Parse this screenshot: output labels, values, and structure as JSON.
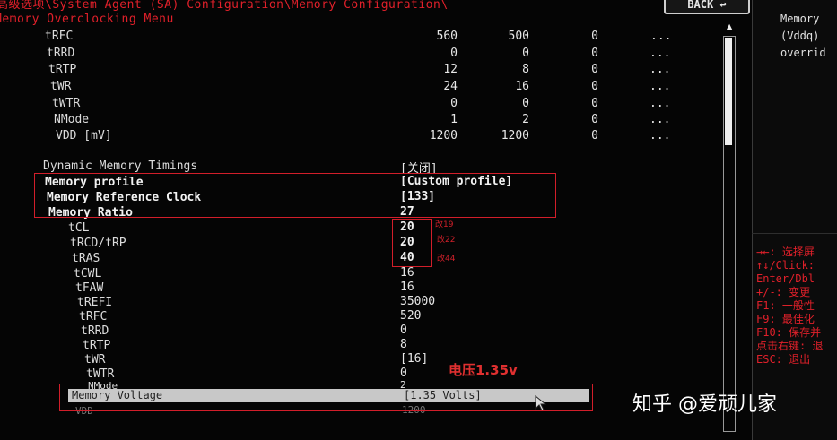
{
  "header": {
    "breadcrumb": "\\System Agent (SA) Configuration\\Memory Configuration\\",
    "menu_title": "Memory Overclocking Menu",
    "back_label": "BACK"
  },
  "top_table": {
    "rows": [
      {
        "label": "tRFC",
        "v1": "560",
        "v2": "500",
        "v3": "0",
        "v4": "..."
      },
      {
        "label": "tRRD",
        "v1": "0",
        "v2": "0",
        "v3": "0",
        "v4": "..."
      },
      {
        "label": "tRTP",
        "v1": "12",
        "v2": "8",
        "v3": "0",
        "v4": "..."
      },
      {
        "label": "tWR",
        "v1": "24",
        "v2": "16",
        "v3": "0",
        "v4": "..."
      },
      {
        "label": "tWTR",
        "v1": "0",
        "v2": "0",
        "v3": "0",
        "v4": "..."
      },
      {
        "label": "NMode",
        "v1": "1",
        "v2": "2",
        "v3": "0",
        "v4": "..."
      },
      {
        "label": "VDD [mV]",
        "v1": "1200",
        "v2": "1200",
        "v3": "0",
        "v4": "..."
      }
    ]
  },
  "settings": [
    {
      "label": "Dynamic Memory Timings",
      "value": "[关闭]"
    },
    {
      "label": "Memory profile",
      "value": "[Custom profile]"
    },
    {
      "label": "Memory Reference Clock",
      "value": "[133]"
    },
    {
      "label": "Memory Ratio",
      "value": "27"
    }
  ],
  "timings": [
    {
      "label": "tCL",
      "value": "20"
    },
    {
      "label": "tRCD/tRP",
      "value": "20"
    },
    {
      "label": "tRAS",
      "value": "40"
    },
    {
      "label": "tCWL",
      "value": "16"
    },
    {
      "label": "tFAW",
      "value": "16"
    },
    {
      "label": "tREFI",
      "value": "35000"
    },
    {
      "label": "tRFC",
      "value": "520"
    },
    {
      "label": "tRRD",
      "value": "0"
    },
    {
      "label": "tRTP",
      "value": "8"
    },
    {
      "label": "tWR",
      "value": "[16]"
    },
    {
      "label": "tWTR",
      "value": "0"
    },
    {
      "label": "NMode",
      "value": "2"
    }
  ],
  "voltage": {
    "label": "Memory Voltage",
    "value": "[1.35 Volts]"
  },
  "vdd_bottom": {
    "label": "VDD",
    "value": "1200"
  },
  "annotations": {
    "tcl_note": "改19",
    "trcd_note": "改22",
    "tras_note": "改44",
    "voltage_note": "电压1.35v"
  },
  "help_panel": {
    "desc_lines": [
      "Memory",
      "(Vddq)",
      "overrid"
    ],
    "keys": [
      "→←: 选择屏",
      "↑↓/Click:",
      "Enter/Dbl",
      "+/-: 变更",
      "F1: 一般性",
      "F9: 最佳化",
      "F10: 保存并",
      "点击右键: 退",
      "ESC: 退出"
    ]
  },
  "watermark": "知乎 @爱顽儿家"
}
